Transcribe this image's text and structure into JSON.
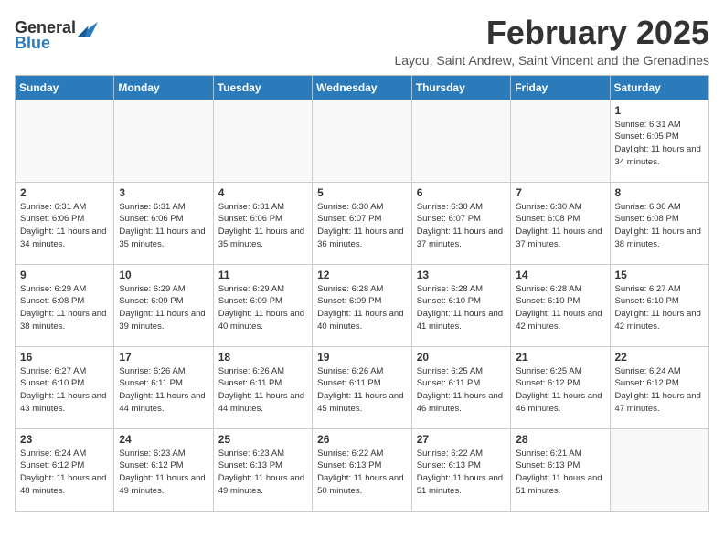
{
  "logo": {
    "general": "General",
    "blue": "Blue"
  },
  "title": "February 2025",
  "subtitle": "Layou, Saint Andrew, Saint Vincent and the Grenadines",
  "days_of_week": [
    "Sunday",
    "Monday",
    "Tuesday",
    "Wednesday",
    "Thursday",
    "Friday",
    "Saturday"
  ],
  "weeks": [
    [
      {
        "day": "",
        "info": ""
      },
      {
        "day": "",
        "info": ""
      },
      {
        "day": "",
        "info": ""
      },
      {
        "day": "",
        "info": ""
      },
      {
        "day": "",
        "info": ""
      },
      {
        "day": "",
        "info": ""
      },
      {
        "day": "1",
        "info": "Sunrise: 6:31 AM\nSunset: 6:05 PM\nDaylight: 11 hours and 34 minutes."
      }
    ],
    [
      {
        "day": "2",
        "info": "Sunrise: 6:31 AM\nSunset: 6:06 PM\nDaylight: 11 hours and 34 minutes."
      },
      {
        "day": "3",
        "info": "Sunrise: 6:31 AM\nSunset: 6:06 PM\nDaylight: 11 hours and 35 minutes."
      },
      {
        "day": "4",
        "info": "Sunrise: 6:31 AM\nSunset: 6:06 PM\nDaylight: 11 hours and 35 minutes."
      },
      {
        "day": "5",
        "info": "Sunrise: 6:30 AM\nSunset: 6:07 PM\nDaylight: 11 hours and 36 minutes."
      },
      {
        "day": "6",
        "info": "Sunrise: 6:30 AM\nSunset: 6:07 PM\nDaylight: 11 hours and 37 minutes."
      },
      {
        "day": "7",
        "info": "Sunrise: 6:30 AM\nSunset: 6:08 PM\nDaylight: 11 hours and 37 minutes."
      },
      {
        "day": "8",
        "info": "Sunrise: 6:30 AM\nSunset: 6:08 PM\nDaylight: 11 hours and 38 minutes."
      }
    ],
    [
      {
        "day": "9",
        "info": "Sunrise: 6:29 AM\nSunset: 6:08 PM\nDaylight: 11 hours and 38 minutes."
      },
      {
        "day": "10",
        "info": "Sunrise: 6:29 AM\nSunset: 6:09 PM\nDaylight: 11 hours and 39 minutes."
      },
      {
        "day": "11",
        "info": "Sunrise: 6:29 AM\nSunset: 6:09 PM\nDaylight: 11 hours and 40 minutes."
      },
      {
        "day": "12",
        "info": "Sunrise: 6:28 AM\nSunset: 6:09 PM\nDaylight: 11 hours and 40 minutes."
      },
      {
        "day": "13",
        "info": "Sunrise: 6:28 AM\nSunset: 6:10 PM\nDaylight: 11 hours and 41 minutes."
      },
      {
        "day": "14",
        "info": "Sunrise: 6:28 AM\nSunset: 6:10 PM\nDaylight: 11 hours and 42 minutes."
      },
      {
        "day": "15",
        "info": "Sunrise: 6:27 AM\nSunset: 6:10 PM\nDaylight: 11 hours and 42 minutes."
      }
    ],
    [
      {
        "day": "16",
        "info": "Sunrise: 6:27 AM\nSunset: 6:10 PM\nDaylight: 11 hours and 43 minutes."
      },
      {
        "day": "17",
        "info": "Sunrise: 6:26 AM\nSunset: 6:11 PM\nDaylight: 11 hours and 44 minutes."
      },
      {
        "day": "18",
        "info": "Sunrise: 6:26 AM\nSunset: 6:11 PM\nDaylight: 11 hours and 44 minutes."
      },
      {
        "day": "19",
        "info": "Sunrise: 6:26 AM\nSunset: 6:11 PM\nDaylight: 11 hours and 45 minutes."
      },
      {
        "day": "20",
        "info": "Sunrise: 6:25 AM\nSunset: 6:11 PM\nDaylight: 11 hours and 46 minutes."
      },
      {
        "day": "21",
        "info": "Sunrise: 6:25 AM\nSunset: 6:12 PM\nDaylight: 11 hours and 46 minutes."
      },
      {
        "day": "22",
        "info": "Sunrise: 6:24 AM\nSunset: 6:12 PM\nDaylight: 11 hours and 47 minutes."
      }
    ],
    [
      {
        "day": "23",
        "info": "Sunrise: 6:24 AM\nSunset: 6:12 PM\nDaylight: 11 hours and 48 minutes."
      },
      {
        "day": "24",
        "info": "Sunrise: 6:23 AM\nSunset: 6:12 PM\nDaylight: 11 hours and 49 minutes."
      },
      {
        "day": "25",
        "info": "Sunrise: 6:23 AM\nSunset: 6:13 PM\nDaylight: 11 hours and 49 minutes."
      },
      {
        "day": "26",
        "info": "Sunrise: 6:22 AM\nSunset: 6:13 PM\nDaylight: 11 hours and 50 minutes."
      },
      {
        "day": "27",
        "info": "Sunrise: 6:22 AM\nSunset: 6:13 PM\nDaylight: 11 hours and 51 minutes."
      },
      {
        "day": "28",
        "info": "Sunrise: 6:21 AM\nSunset: 6:13 PM\nDaylight: 11 hours and 51 minutes."
      },
      {
        "day": "",
        "info": ""
      }
    ]
  ]
}
